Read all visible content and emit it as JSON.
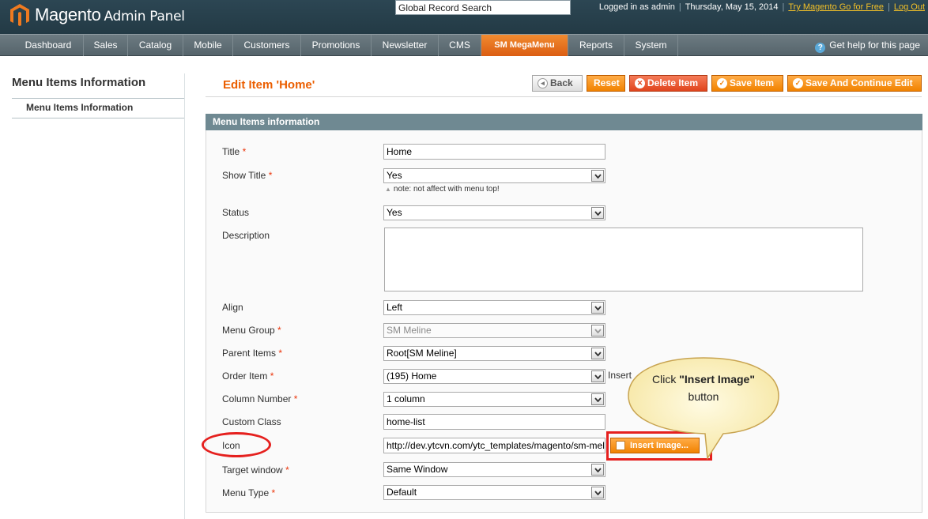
{
  "header": {
    "logo_word": "Magento",
    "logo_sub": "Admin Panel",
    "search_value": "Global Record Search",
    "logged_in": "Logged in as admin",
    "date": "Thursday, May 15, 2014",
    "try_link": "Try Magento Go for Free",
    "logout": "Log Out"
  },
  "nav": {
    "items": [
      "Dashboard",
      "Sales",
      "Catalog",
      "Mobile",
      "Customers",
      "Promotions",
      "Newsletter",
      "CMS",
      "SM MegaMenu",
      "Reports",
      "System"
    ],
    "active": "SM MegaMenu",
    "help": "Get help for this page"
  },
  "sidebar": {
    "title": "Menu Items Information",
    "items": [
      "Menu Items Information"
    ]
  },
  "page": {
    "title": "Edit Item 'Home'",
    "buttons": {
      "back": "Back",
      "reset": "Reset",
      "delete": "Delete Item",
      "save": "Save Item",
      "save_continue": "Save And Continue Edit"
    }
  },
  "section": {
    "title": "Menu Items information",
    "fields": {
      "title": {
        "label": "Title",
        "value": "Home"
      },
      "show_title": {
        "label": "Show Title",
        "value": "Yes",
        "note": "note: not affect with menu top!"
      },
      "status": {
        "label": "Status",
        "value": "Yes"
      },
      "description": {
        "label": "Description",
        "value": ""
      },
      "align": {
        "label": "Align",
        "value": "Left"
      },
      "menu_group": {
        "label": "Menu Group",
        "value": "SM Meline"
      },
      "parent_items": {
        "label": "Parent Items",
        "value": "Root[SM Meline]"
      },
      "order_item": {
        "label": "Order Item",
        "value": "(195) Home",
        "extra": "Insert"
      },
      "column_number": {
        "label": "Column Number",
        "value": "1 column"
      },
      "custom_class": {
        "label": "Custom Class",
        "value": "home-list"
      },
      "icon": {
        "label": "Icon",
        "value": "http://dev.ytcvn.com/ytc_templates/magento/sm-meline/media/",
        "button": "Insert Image..."
      },
      "target_window": {
        "label": "Target window",
        "value": "Same Window"
      },
      "menu_type": {
        "label": "Menu Type",
        "value": "Default"
      }
    }
  },
  "callout": {
    "pre": "Click ",
    "bold": "\"Insert Image\"",
    "post": " button"
  },
  "colors": {
    "accent_orange": "#f18200",
    "header_bg": "#2c4653",
    "section_head": "#6f8992",
    "annotation_red": "#e5201e",
    "callout_fill": "#fdf4c4"
  }
}
